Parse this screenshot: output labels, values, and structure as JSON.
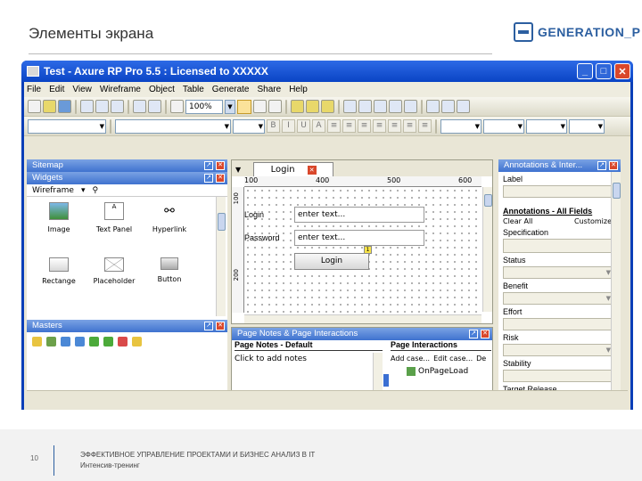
{
  "slide": {
    "title": "Элементы экрана",
    "page_number": "10",
    "footer_line1": "ЭФФЕКТИВНОЕ УПРАВЛЕНИЕ ПРОЕКТАМИ И БИЗНЕС АНАЛИЗ В IT",
    "footer_line2": "Интенсив-тренинг"
  },
  "logo": {
    "text": "GENERATION_P",
    "color": "#2c5fa0"
  },
  "window": {
    "title": "Test - Axure RP Pro 5.5 : Licensed to XXXXX",
    "menu": [
      "File",
      "Edit",
      "View",
      "Wireframe",
      "Object",
      "Table",
      "Generate",
      "Share",
      "Help"
    ],
    "zoom": "100%"
  },
  "sitemap": {
    "title": "Sitemap"
  },
  "widgets": {
    "title": "Widgets",
    "library": "Wireframe",
    "items": [
      {
        "label": "Image",
        "icon": "image-icon"
      },
      {
        "label": "Text Panel",
        "icon": "text-panel-icon"
      },
      {
        "label": "Hyperlink",
        "icon": "hyperlink-icon"
      },
      {
        "label": "Rectange",
        "icon": "rectangle-icon"
      },
      {
        "label": "Placeholder",
        "icon": "placeholder-icon"
      },
      {
        "label": "Button",
        "icon": "button-icon"
      }
    ]
  },
  "masters": {
    "title": "Masters"
  },
  "canvas": {
    "tab": "Login",
    "ruler_top": [
      "100",
      "400",
      "500",
      "600"
    ],
    "ruler_left": [
      "100",
      "200"
    ],
    "login_label": "Login",
    "password_label": "Password",
    "input_placeholder": "enter text...",
    "login_button": "Login",
    "marker": "1"
  },
  "notes": {
    "title": "Page Notes & Page Interactions",
    "notes_header": "Page Notes - Default",
    "notes_placeholder": "Click to add notes",
    "interactions_header": "Page Interactions",
    "add_case": "Add case...",
    "edit_case": "Edit case...",
    "delete_case": "De",
    "event": "OnPageLoad"
  },
  "annotations": {
    "title": "Annotations & Inter...",
    "label_field": "Label",
    "fields_header": "Annotations - All Fields",
    "clear_all": "Clear All",
    "customize": "Customize",
    "fields": [
      "Specification",
      "Status",
      "Benefit",
      "Effort",
      "Risk",
      "Stability",
      "Target Release"
    ]
  }
}
